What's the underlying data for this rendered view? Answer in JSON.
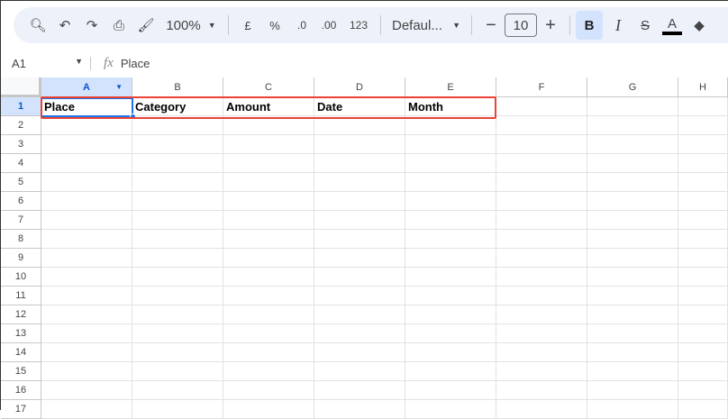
{
  "toolbar": {
    "zoom": "100%",
    "currency": "£",
    "percent": "%",
    "dec_decrease": ".0",
    "dec_increase": ".00",
    "format_number": "123",
    "font": "Defaul...",
    "font_size": "10",
    "bold": "B",
    "italic": "I",
    "text_color": "A"
  },
  "formula_bar": {
    "cell_ref": "A1",
    "fx": "fx",
    "value": "Place"
  },
  "columns": [
    "A",
    "B",
    "C",
    "D",
    "E",
    "F",
    "G",
    "H"
  ],
  "rows": [
    "1",
    "2",
    "3",
    "4",
    "5",
    "6",
    "7",
    "8",
    "9",
    "10",
    "11",
    "12",
    "13",
    "14",
    "15",
    "16",
    "17"
  ],
  "row1": [
    "Place",
    "Category",
    "Amount",
    "Date",
    "Month"
  ],
  "colors": {
    "selection": "#1a73e8",
    "highlight_box": "#ea4335",
    "header_selected": "#d3e3fd"
  }
}
